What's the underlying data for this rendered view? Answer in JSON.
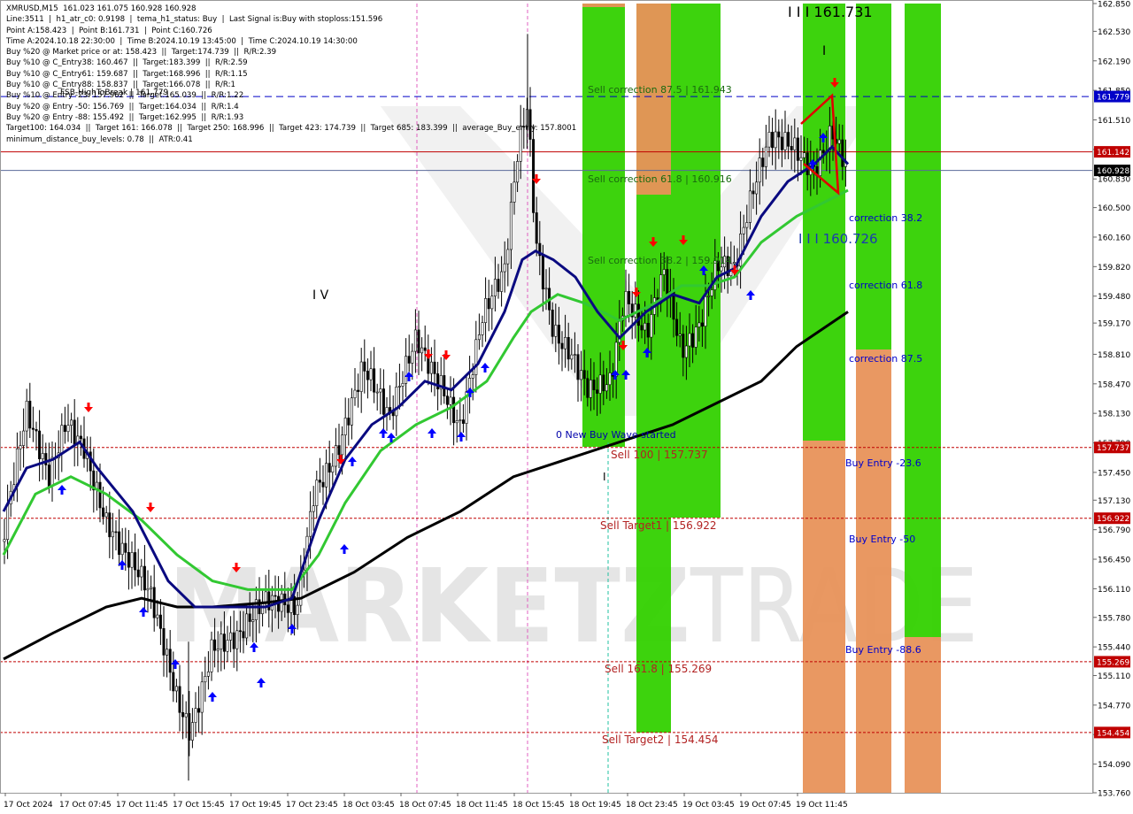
{
  "header": {
    "lines": [
      "XMRUSD,M15  161.023 161.075 160.928 160.928",
      "Line:3511  |  h1_atr_c0: 0.9198  |  tema_h1_status: Buy  |  Last Signal is:Buy with stoploss:151.596",
      "Point A:158.423  |  Point B:161.731  |  Point C:160.726",
      "Time A:2024.10.18 22:30:00  |  Time B:2024.10.19 13:45:00  |  Time C:2024.10.19 14:30:00",
      "Buy %20 @ Market price or at: 158.423  ||  Target:174.739  ||  R/R:2.39",
      "Buy %10 @ C_Entry38: 160.467  ||  Target:183.399  ||  R/R:2.59",
      "Buy %10 @ C_Entry61: 159.687  ||  Target:168.996  ||  R/R:1.15",
      "Buy %10 @ C_Entry88: 158.837  ||  Target:166.078  ||  R/R:1",
      "Buy %10 @ Entry -23: 157.962  ||  Target:165.039  ||  R/R:1.22",
      "Buy %20 @ Entry -50: 156.769  ||  Target:164.034  ||  R/R:1.4",
      "Buy %20 @ Entry -88: 155.492  ||  Target:162.995  ||  R/R:1.93",
      "Target100: 164.034  ||  Target 161: 166.078  ||  Target 250: 168.996  ||  Target 423: 174.739  ||  Target 685: 183.399  ||  average_Buy_entry: 157.8001",
      "minimum_distance_buy_levels: 0.78  ||  ATR:0.41"
    ]
  },
  "colors": {
    "green_zone": "#33d100",
    "orange_zone": "#e8925a",
    "navy_ma": "#0a0a80",
    "green_ma": "#32c832",
    "black_ma": "#000000",
    "red_level": "#c00000",
    "blue_level": "#0000c8",
    "sell_label": "#b22222",
    "buy_label": "#0000cc",
    "price_box": "#c00000",
    "watermark": "#d0d0d0"
  },
  "chart_data": {
    "type": "candlestick",
    "symbol": "XMRUSD",
    "timeframe": "M15",
    "ylim": [
      153.76,
      162.85
    ],
    "y_ticks": [
      "162.850",
      "162.530",
      "162.190",
      "161.850",
      "161.510",
      "161.170",
      "160.830",
      "160.500",
      "160.160",
      "159.820",
      "159.480",
      "159.170",
      "158.810",
      "158.470",
      "158.130",
      "157.790",
      "157.450",
      "157.130",
      "156.790",
      "156.450",
      "156.110",
      "155.780",
      "155.440",
      "155.110",
      "154.770",
      "154.430",
      "154.090",
      "153.760"
    ],
    "x_ticks": [
      "17 Oct 2024",
      "17 Oct 07:45",
      "17 Oct 11:45",
      "17 Oct 15:45",
      "17 Oct 19:45",
      "17 Oct 23:45",
      "18 Oct 03:45",
      "18 Oct 07:45",
      "18 Oct 11:45",
      "18 Oct 15:45",
      "18 Oct 19:45",
      "18 Oct 23:45",
      "19 Oct 03:45",
      "19 Oct 07:45",
      "19 Oct 11:45"
    ],
    "current_price": "160.928",
    "price_boxes": [
      {
        "value": 161.779,
        "label": "161.779",
        "color": "#0000c8"
      },
      {
        "value": 161.142,
        "label": "161.142",
        "color": "#c00000"
      },
      {
        "value": 160.928,
        "label": "160.928",
        "color": "#000000"
      },
      {
        "value": 157.737,
        "label": "157.737",
        "color": "#c00000"
      },
      {
        "value": 156.922,
        "label": "156.922",
        "color": "#c00000"
      },
      {
        "value": 155.269,
        "label": "155.269",
        "color": "#c00000"
      },
      {
        "value": 154.454,
        "label": "154.454",
        "color": "#c00000"
      }
    ],
    "levels": [
      {
        "value": 161.779,
        "style": "dashed",
        "color": "#0000c8"
      },
      {
        "value": 161.142,
        "style": "solid",
        "color": "#c00000"
      },
      {
        "value": 160.928,
        "style": "solid",
        "color": "#5a6a9a"
      },
      {
        "value": 157.737,
        "style": "dotted",
        "color": "#c00000"
      },
      {
        "value": 156.922,
        "style": "dotted",
        "color": "#c00000"
      },
      {
        "value": 155.269,
        "style": "dotted",
        "color": "#c00000"
      },
      {
        "value": 154.454,
        "style": "dotted",
        "color": "#c00000"
      }
    ],
    "annotations": {
      "sell_corr_875": "Sell correction 87.5 | 161.943",
      "sell_corr_618": "Sell correction 61.8 | 160.916",
      "sell_corr_382": "Sell correction 38.2 | 159.914",
      "wave_start": "0 New Buy Wave started",
      "sell_100": "Sell 100 | 157.737",
      "sell_target1": "Sell Target1 | 156.922",
      "sell_1618": "Sell 161.8 | 155.269",
      "sell_target2": "Sell Target2 | 154.454",
      "corr_382": "correction 38.2",
      "corr_618": "correction 61.8",
      "corr_875": "correction 87.5",
      "buy_entry_236": "Buy Entry -23.6",
      "buy_entry_50": "Buy Entry -50",
      "buy_entry_886": "Buy Entry -88.6",
      "point_b": "I I I 161.731",
      "point_c": "I I I 160.726",
      "wave_iv": "I V",
      "mark_i_top": "I",
      "mark_i_bottom": "I",
      "fsb": "FSB-HighToBreak  |  161.779"
    }
  },
  "watermark": {
    "part1": "MARKETZ",
    "part2": "TRADE"
  }
}
